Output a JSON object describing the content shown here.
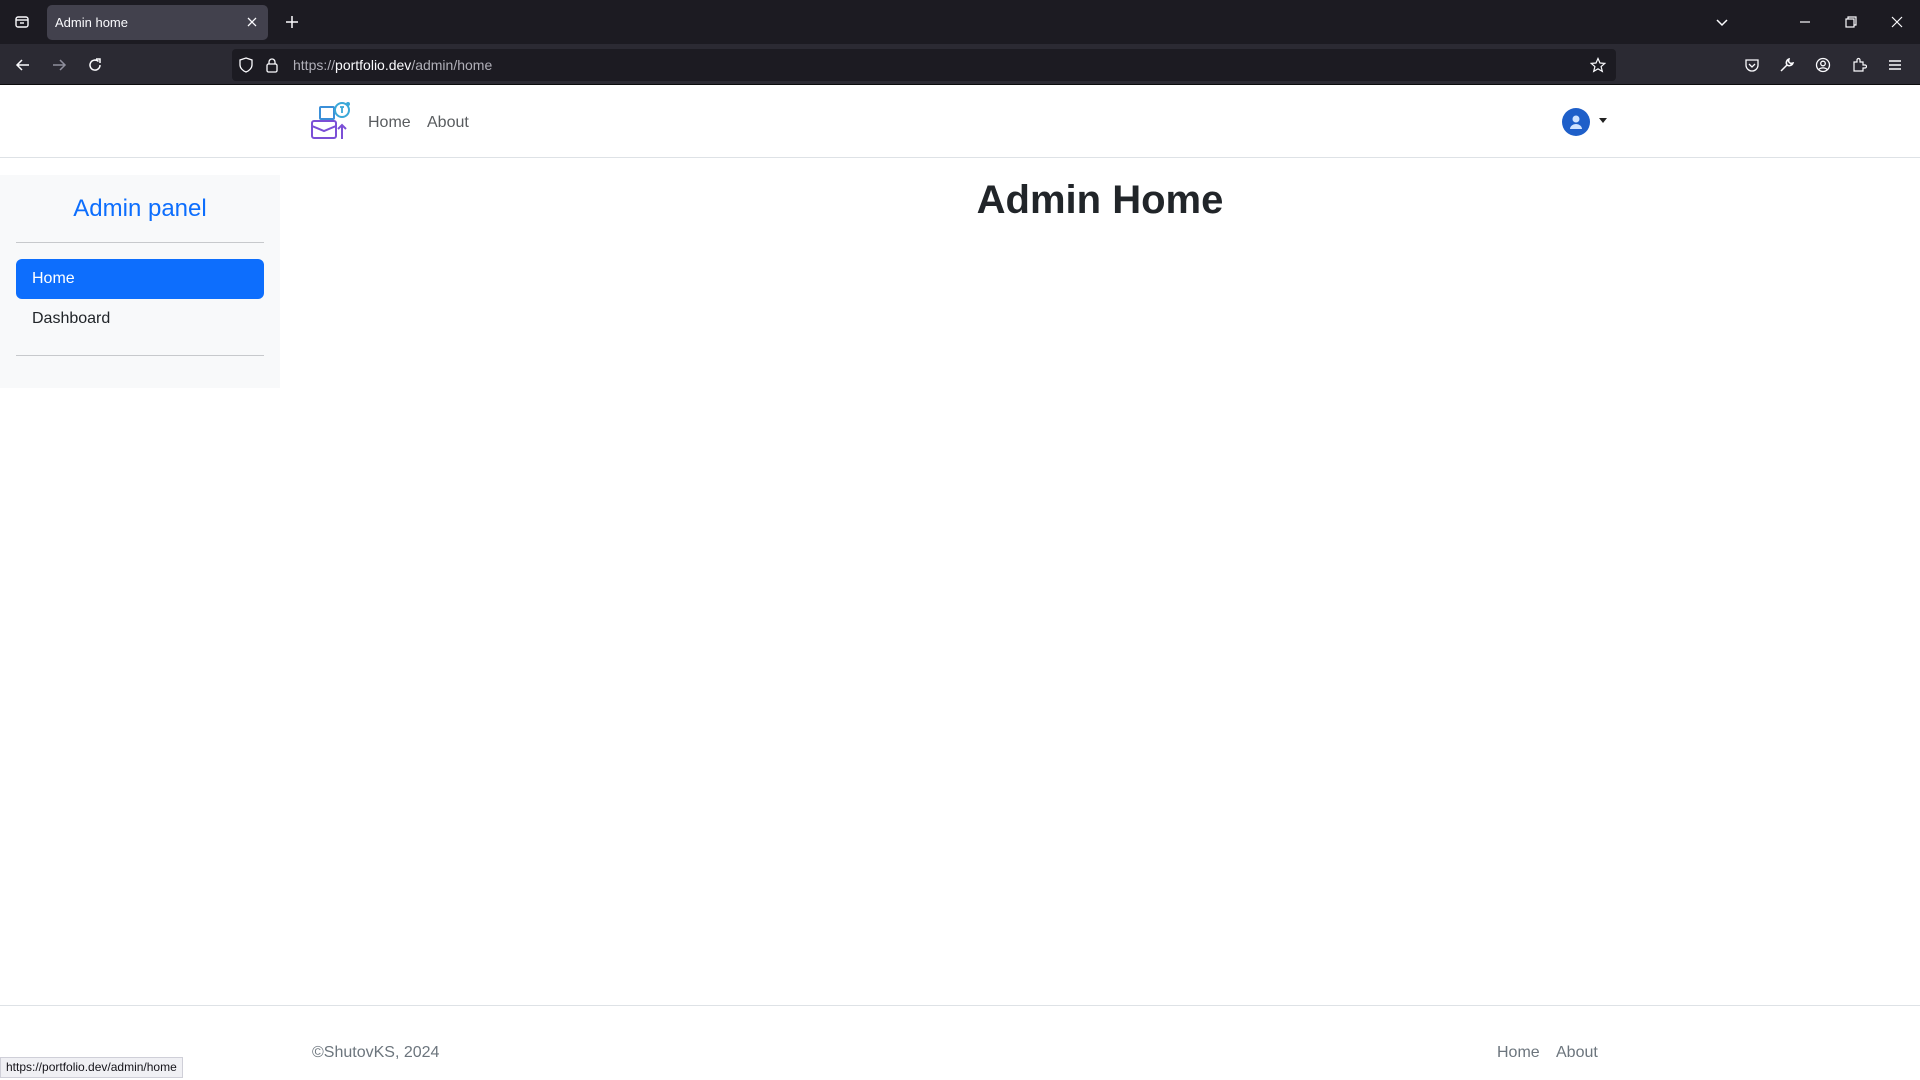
{
  "browser": {
    "tab_title": "Admin home",
    "url_prefix": "https://",
    "url_host": "portfolio.dev",
    "url_path": "/admin/home",
    "status_url": "https://portfolio.dev/admin/home"
  },
  "header": {
    "nav": [
      {
        "label": "Home"
      },
      {
        "label": "About"
      }
    ]
  },
  "sidebar": {
    "title": "Admin panel",
    "items": [
      {
        "label": "Home",
        "active": true
      },
      {
        "label": "Dashboard",
        "active": false
      }
    ]
  },
  "main": {
    "title": "Admin Home"
  },
  "footer": {
    "copyright": "©ShutovKS, 2024",
    "links": [
      {
        "label": "Home"
      },
      {
        "label": "About"
      }
    ]
  },
  "colors": {
    "accent": "#0d6efd",
    "chrome_dark": "#1c1b22",
    "sidebar_bg": "#f8f9fa"
  }
}
